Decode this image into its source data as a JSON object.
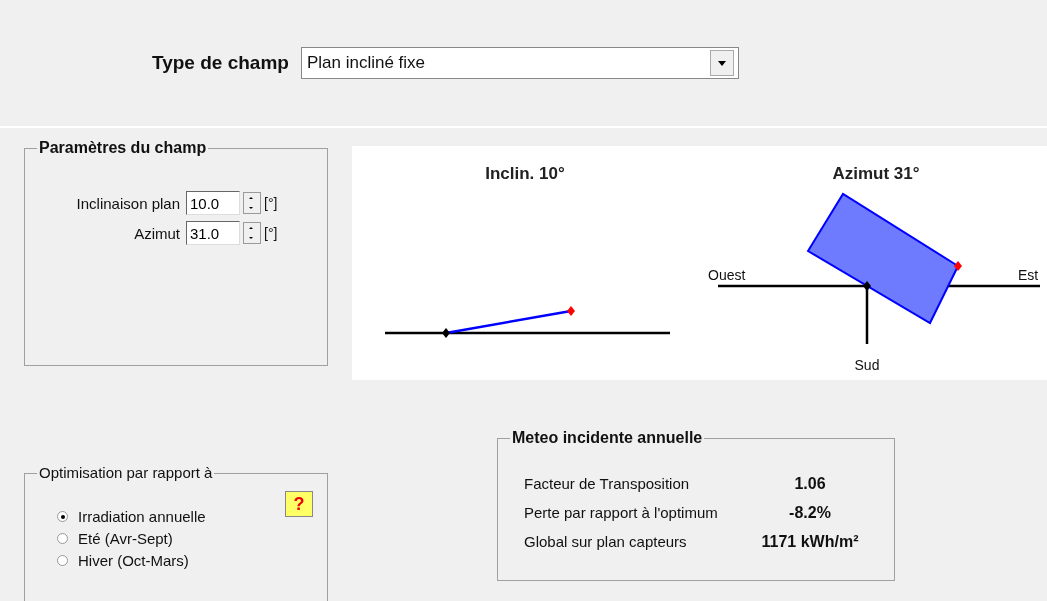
{
  "field_type": {
    "label": "Type de champ",
    "value": "Plan incliné fixe"
  },
  "parameters": {
    "title": "Paramètres du champ",
    "fields": [
      {
        "label": "Inclinaison plan",
        "value": "10.0",
        "unit": "[°]"
      },
      {
        "label": "Azimut",
        "value": "31.0",
        "unit": "[°]"
      }
    ]
  },
  "diagrams": {
    "tilt_title": "Inclin. 10°",
    "azimuth_title": "Azimut 31°",
    "west": "Ouest",
    "east": "Est",
    "south": "Sud"
  },
  "optimisation": {
    "title": "Optimisation par rapport à",
    "help": "?",
    "options": [
      {
        "label": "Irradiation annuelle",
        "selected": true
      },
      {
        "label": "Eté (Avr-Sept)",
        "selected": false
      },
      {
        "label": "Hiver (Oct-Mars)",
        "selected": false
      }
    ]
  },
  "meteo": {
    "title": "Meteo incidente annuelle",
    "rows": [
      {
        "label": "Facteur de Transposition",
        "value": "1.06"
      },
      {
        "label": "Perte par rapport à l'optimum",
        "value": "-8.2%"
      },
      {
        "label": "Global sur plan capteurs",
        "value": "1171 kWh/m²"
      }
    ]
  }
}
